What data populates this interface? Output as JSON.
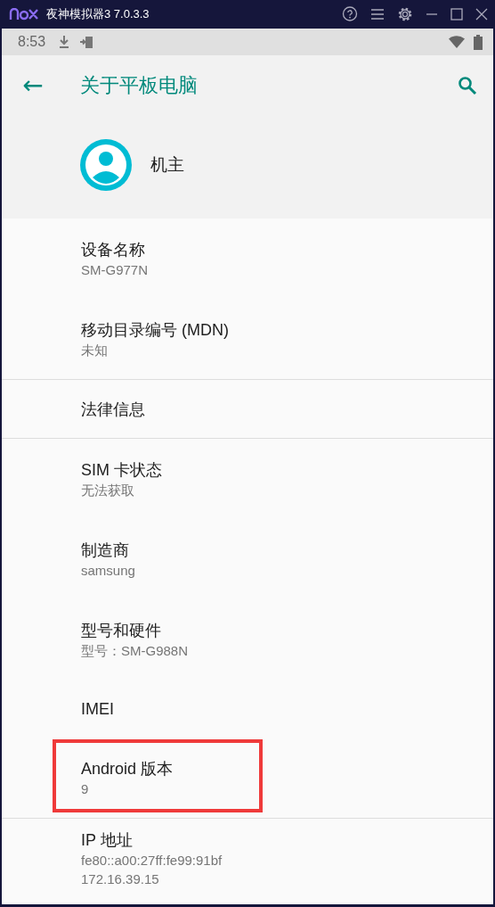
{
  "window": {
    "title": "夜神模拟器3 7.0.3.3"
  },
  "status_bar": {
    "time": "8:53"
  },
  "app_bar": {
    "back": "←",
    "title": "关于平板电脑"
  },
  "account": {
    "name": "机主"
  },
  "groups": [
    {
      "items": [
        {
          "title": "设备名称",
          "summary_lines": [
            "SM-G977N"
          ],
          "highlighted": false
        },
        {
          "title": "移动目录编号 (MDN)",
          "summary_lines": [
            "未知"
          ],
          "highlighted": false
        }
      ]
    },
    {
      "items": [
        {
          "title": "法律信息",
          "highlighted": false
        }
      ]
    },
    {
      "items": [
        {
          "title": "SIM 卡状态",
          "summary_lines": [
            "无法获取"
          ],
          "highlighted": false
        },
        {
          "title": "制造商",
          "summary_lines": [
            "samsung"
          ],
          "highlighted": false
        },
        {
          "title": "型号和硬件",
          "summary_lines": [
            "型号：SM-G988N"
          ],
          "highlighted": false
        },
        {
          "title": "IMEI",
          "highlighted": false
        },
        {
          "title": "Android 版本",
          "summary_lines": [
            "9"
          ],
          "highlighted": true
        }
      ]
    },
    {
      "items": [
        {
          "title": "IP 地址",
          "summary_lines": [
            "fe80::a00:27ff:fe99:91bf",
            "172.16.39.15"
          ],
          "highlighted": false
        }
      ]
    }
  ]
}
